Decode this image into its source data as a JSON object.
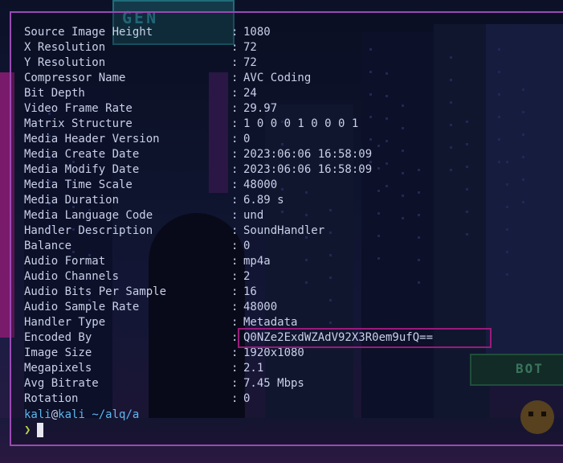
{
  "background": {
    "sign_top": "GEN",
    "sign_right": "BOT"
  },
  "metadata": [
    {
      "key": "Source Image Height",
      "value": "1080"
    },
    {
      "key": "X Resolution",
      "value": "72"
    },
    {
      "key": "Y Resolution",
      "value": "72"
    },
    {
      "key": "Compressor Name",
      "value": "AVC Coding"
    },
    {
      "key": "Bit Depth",
      "value": "24"
    },
    {
      "key": "Video Frame Rate",
      "value": "29.97"
    },
    {
      "key": "Matrix Structure",
      "value": "1 0 0 0 1 0 0 0 1"
    },
    {
      "key": "Media Header Version",
      "value": "0"
    },
    {
      "key": "Media Create Date",
      "value": "2023:06:06 16:58:09"
    },
    {
      "key": "Media Modify Date",
      "value": "2023:06:06 16:58:09"
    },
    {
      "key": "Media Time Scale",
      "value": "48000"
    },
    {
      "key": "Media Duration",
      "value": "6.89 s"
    },
    {
      "key": "Media Language Code",
      "value": "und"
    },
    {
      "key": "Handler Description",
      "value": "SoundHandler"
    },
    {
      "key": "Balance",
      "value": "0"
    },
    {
      "key": "Audio Format",
      "value": "mp4a"
    },
    {
      "key": "Audio Channels",
      "value": "2"
    },
    {
      "key": "Audio Bits Per Sample",
      "value": "16"
    },
    {
      "key": "Audio Sample Rate",
      "value": "48000"
    },
    {
      "key": "Handler Type",
      "value": "Metadata"
    },
    {
      "key": "Encoded By",
      "value": "Q0NZe2ExdWZAdV92X3R0em9ufQ=="
    },
    {
      "key": "Image Size",
      "value": "1920x1080"
    },
    {
      "key": "Megapixels",
      "value": "2.1"
    },
    {
      "key": "Avg Bitrate",
      "value": "7.45 Mbps"
    },
    {
      "key": "Rotation",
      "value": "0"
    }
  ],
  "separator": ":",
  "prompt": {
    "user": "kali",
    "at": "@",
    "host": "kali",
    "path": "~/alq/a",
    "symbol": "❯"
  },
  "colors": {
    "terminal_border": "#9a49b4",
    "highlight_box": "#9b1a7c",
    "prompt_blue": "#5fb7f0",
    "prompt_symbol": "#b3d34a"
  }
}
